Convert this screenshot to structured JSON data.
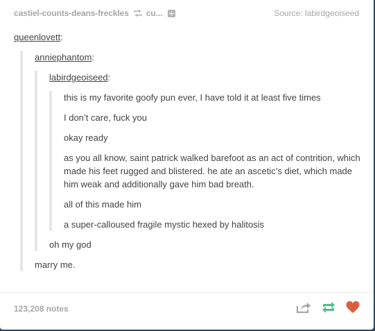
{
  "header": {
    "trail_user": "castiel-counts-deans-freckles",
    "trail_next": "cu...",
    "source_label": "Source: labirdgeoiseed"
  },
  "post": {
    "author": "queenlovett",
    "quote1": {
      "author": "anniephantom",
      "quote2": {
        "author": "labirdgeoiseed",
        "lines": [
          "this is my favorite goofy pun ever, I have told it at least five times",
          "I don’t care, fuck you",
          "okay ready",
          "as you all know, saint patrick walked barefoot as an act of contrition, which made his feet rugged and blistered. he ate an ascetic’s diet, which made him weak and additionally gave him bad breath.",
          "all of this made him",
          "a super-calloused fragile mystic hexed by halitosis"
        ]
      },
      "reply": "oh my god"
    },
    "reply": "marry me."
  },
  "footer": {
    "notes": "123,208 notes",
    "share_icon": "share-icon",
    "reblog_icon": "reblog-icon",
    "like_icon": "heart-icon",
    "reblog_color": "#56bc8a",
    "like_color": "#d95e40"
  }
}
